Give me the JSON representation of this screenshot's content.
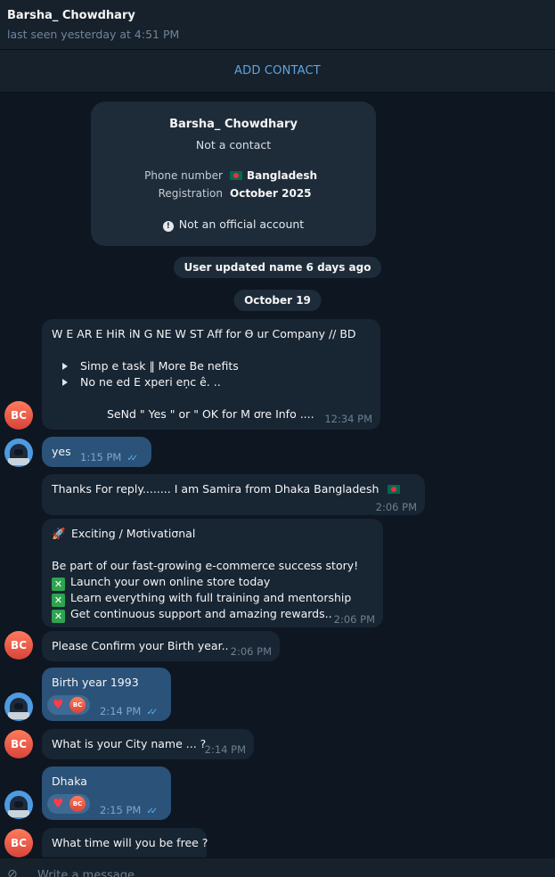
{
  "header": {
    "name": "Barsha_ Chowdhary",
    "status": "last seen yesterday at 4:51 PM"
  },
  "add_contact": {
    "label": "ADD CONTACT"
  },
  "info_card": {
    "name": "Barsha_ Chowdhary",
    "subtitle": "Not a contact",
    "phone_label": "Phone number",
    "phone_value": "Bangladesh",
    "registration_label": "Registration",
    "registration_value": "October 2025",
    "official_note": "Not an official account"
  },
  "service": {
    "name_update": "User updated name 6 days ago",
    "date": "October 19"
  },
  "messages": {
    "m1": {
      "line1": "W E AR E HiR iN G NE W ST Aff for Ө ur Company //    BD",
      "bullet1": "Simp e task  ‖    More  Be nefits",
      "bullet2": "No ne ed E xperi eņc ê. ..",
      "line4": "SeNd \" Yes \"  or  \"  OK  for M ơre Info ....",
      "time": "12:34 PM"
    },
    "m2": {
      "text": "yes",
      "time": "1:15 PM"
    },
    "m3": {
      "text": "Thanks For reply........   I am Samira from Dhaka Bangladesh",
      "time": "2:06 PM"
    },
    "m4": {
      "title": "Exciting / Mσtivatiσnal",
      "line1": "Be part of our fast-growing e-commerce success story!",
      "item1": "Launch your own online store today",
      "item2": "Learn everything with full training and mentorship",
      "item3": "Get continuous support and amazing rewards..",
      "time": "2:06 PM"
    },
    "m5": {
      "text": "Please Confirm your Birth year..",
      "time": "2:06 PM"
    },
    "m6": {
      "text": "Birth year 1993",
      "time": "2:14 PM",
      "reaction_avatar": "BC"
    },
    "m7": {
      "text": "What is your City name ... ?",
      "time": "2:14 PM"
    },
    "m8": {
      "text": "Dhaka",
      "time": "2:15 PM",
      "reaction_avatar": "BC"
    },
    "m9": {
      "text": "What time will you be free ?"
    }
  },
  "avatars": {
    "contact_initials": "BC"
  },
  "composer": {
    "placeholder": "Write a message..."
  },
  "colors": {
    "background": "#0e1621",
    "incoming": "#182533",
    "outgoing": "#2b5278",
    "accent": "#5fa4e0"
  }
}
